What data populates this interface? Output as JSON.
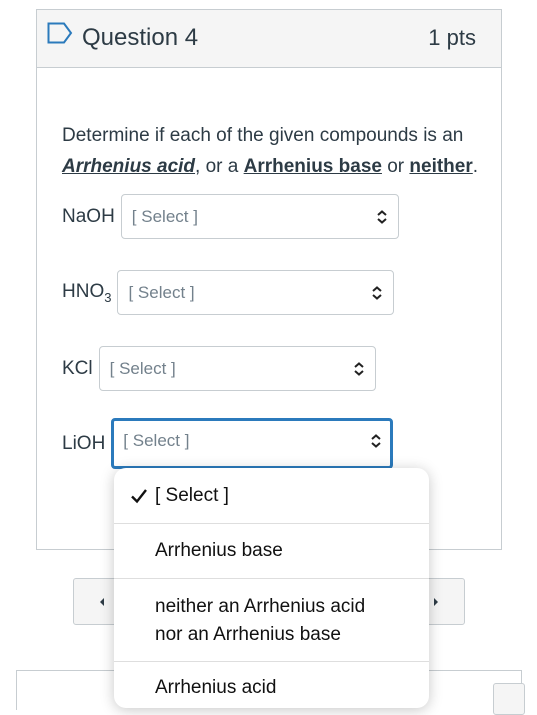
{
  "question": {
    "title": "Question 4",
    "points": "1 pts",
    "prompt_start": "Determine if each of the given compounds is an ",
    "term_acid": "Arrhenius acid",
    "sep1": ", or a ",
    "term_base": "Arrhenius base",
    "sep2": " or ",
    "term_neither": "neither",
    "end": "."
  },
  "compounds": [
    {
      "label": "NaOH",
      "selected": "[ Select ]"
    },
    {
      "label_main": "HNO",
      "label_sub": "3",
      "selected": "[ Select ]"
    },
    {
      "label": "KCl",
      "selected": "[ Select ]"
    },
    {
      "label": "LiOH",
      "selected": "[ Select ]"
    }
  ],
  "dropdown": {
    "checked_prefix": "✓",
    "options": [
      "[ Select ]",
      "Arrhenius base",
      "neither an Arrhenius acid",
      "nor an Arrhenius base",
      "Arrhenius acid"
    ]
  },
  "colors": {
    "focus_border": "#2b7abc",
    "text": "#2d3b45",
    "placeholder": "#73818c"
  },
  "icons": {
    "flag": "bookmark-flag-icon",
    "select": "updown-chevron-icon",
    "prev": "triangle-left-icon",
    "next": "triangle-right-icon",
    "check": "checkmark-icon"
  }
}
